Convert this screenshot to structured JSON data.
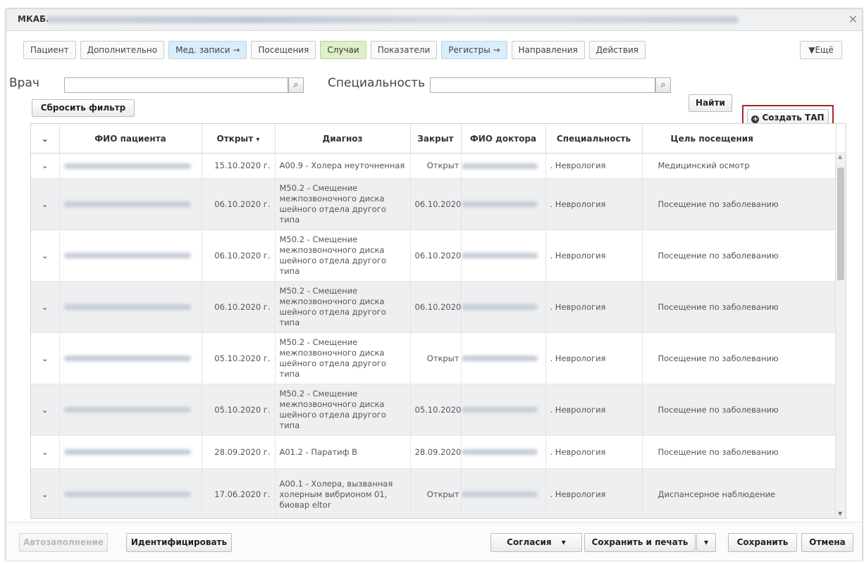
{
  "window": {
    "title": "МКАБ."
  },
  "tabs": [
    {
      "label": "Пациент",
      "style": "normal"
    },
    {
      "label": "Дополнительно",
      "style": "normal"
    },
    {
      "label": "Мед. записи →",
      "style": "blue"
    },
    {
      "label": "Посещения",
      "style": "normal"
    },
    {
      "label": "Случаи",
      "style": "active"
    },
    {
      "label": "Показатели",
      "style": "normal"
    },
    {
      "label": "Регистры →",
      "style": "blue"
    },
    {
      "label": "Направления",
      "style": "normal"
    },
    {
      "label": "Действия",
      "style": "normal"
    }
  ],
  "more_label": "▼Ещё",
  "filter": {
    "doctor_label": "Врач",
    "doctor_value": "",
    "specialty_label": "Специальность",
    "specialty_value": "",
    "find_label": "Найти",
    "reset_label": "Сбросить фильтр",
    "create_label": "Создать ТАП"
  },
  "table": {
    "columns": {
      "expand": "⌄",
      "patient": "ФИО пациента",
      "opened": "Открыт",
      "sort_indicator": "▾",
      "diagnosis": "Диагноз",
      "closed": "Закрыт",
      "doctor": "ФИО доктора",
      "specialty": "Специальность",
      "purpose": "Цель посещения"
    },
    "rows": [
      {
        "opened": "15.10.2020 г.",
        "diagnosis": "A00.9 - Холера неуточненная",
        "closed": "Открыт",
        "specialty": ". Неврология",
        "purpose": "Медицинский осмотр"
      },
      {
        "opened": "06.10.2020 г.",
        "diagnosis": "M50.2 - Смещение межпозвоночного диска шейного отдела другого типа",
        "closed": "06.10.2020 г.",
        "specialty": ". Неврология",
        "purpose": "Посещение по заболеванию"
      },
      {
        "opened": "06.10.2020 г.",
        "diagnosis": "M50.2 - Смещение межпозвоночного диска шейного отдела другого типа",
        "closed": "06.10.2020 г.",
        "specialty": ". Неврология",
        "purpose": "Посещение по заболеванию"
      },
      {
        "opened": "06.10.2020 г.",
        "diagnosis": "M50.2 - Смещение межпозвоночного диска шейного отдела другого типа",
        "closed": "06.10.2020 г.",
        "specialty": ". Неврология",
        "purpose": "Посещение по заболеванию"
      },
      {
        "opened": "05.10.2020 г.",
        "diagnosis": "M50.2 - Смещение межпозвоночного диска шейного отдела другого типа",
        "closed": "Открыт",
        "specialty": ". Неврология",
        "purpose": "Посещение по заболеванию"
      },
      {
        "opened": "05.10.2020 г.",
        "diagnosis": "M50.2 - Смещение межпозвоночного диска шейного отдела другого типа",
        "closed": "05.10.2020 г.",
        "specialty": ". Неврология",
        "purpose": "Посещение по заболеванию"
      },
      {
        "opened": "28.09.2020 г.",
        "diagnosis": "A01.2 - Паратиф B",
        "closed": "28.09.2020 г.",
        "specialty": ". Неврология",
        "purpose": "Посещение по заболеванию"
      },
      {
        "opened": "17.06.2020 г.",
        "diagnosis": "A00.1 - Холера, вызванная холерным вибрионом 01, биовар eltor",
        "closed": "Открыт",
        "specialty": ". Неврология",
        "purpose": "Диспансерное наблюдение"
      }
    ]
  },
  "footer": {
    "autofill_label": "Автозаполнение",
    "identify_label": "Идентифицировать",
    "consents_label": "Согласия",
    "save_print_label": "Сохранить и печать",
    "save_label": "Сохранить",
    "cancel_label": "Отмена"
  },
  "colors": {
    "active_tab": "#dff0c8",
    "blue_tab": "#d9eefa",
    "create_outline": "#a7262a",
    "row_alt": "#eeeff1"
  }
}
